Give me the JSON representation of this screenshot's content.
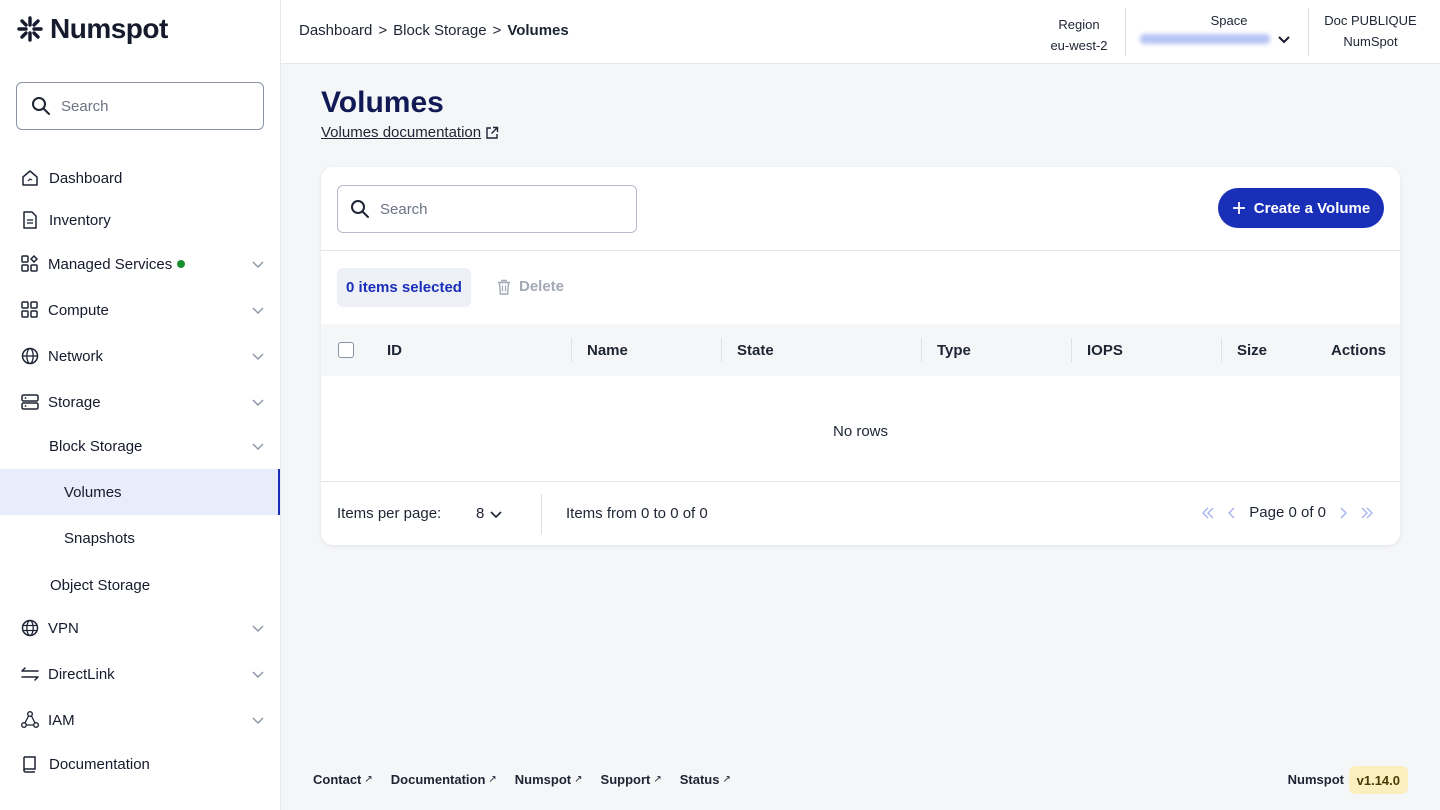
{
  "brand": {
    "name": "Numspot"
  },
  "sidebar": {
    "search_placeholder": "Search",
    "items": [
      {
        "label": "Dashboard"
      },
      {
        "label": "Inventory"
      },
      {
        "label": "Managed Services"
      },
      {
        "label": "Compute"
      },
      {
        "label": "Network"
      },
      {
        "label": "Storage"
      },
      {
        "label": "Block Storage"
      },
      {
        "label": "Volumes"
      },
      {
        "label": "Snapshots"
      },
      {
        "label": "Object Storage"
      },
      {
        "label": "VPN"
      },
      {
        "label": "DirectLink"
      },
      {
        "label": "IAM"
      },
      {
        "label": "Documentation"
      }
    ]
  },
  "header": {
    "breadcrumb": [
      "Dashboard",
      "Block Storage",
      "Volumes"
    ],
    "breadcrumb_sep": ">",
    "region_label": "Region",
    "region_value": "eu-west-2",
    "space_label": "Space",
    "org_label": "Doc PUBLIQUE",
    "org_value": "NumSpot"
  },
  "main": {
    "title": "Volumes",
    "doc_link": "Volumes documentation",
    "search_placeholder": "Search",
    "create_button": "Create a Volume",
    "selected_text": "0 items selected",
    "delete_label": "Delete",
    "columns": [
      "ID",
      "Name",
      "State",
      "Type",
      "IOPS",
      "Size",
      "Actions"
    ],
    "empty_text": "No rows",
    "items_per_page_label": "Items per page:",
    "items_per_page_value": "8",
    "items_range": "Items from 0 to 0 of 0",
    "page_text": "Page 0 of 0"
  },
  "footer": {
    "links": [
      "Contact",
      "Documentation",
      "Numspot",
      "Support",
      "Status"
    ],
    "brand": "Numspot",
    "version": "v1.14.0"
  },
  "colors": {
    "accent": "#1a2fb8",
    "title": "#111a55",
    "active_bg": "#e8ecfb",
    "status_green": "#1a8f2d",
    "version_bg": "#fbefc0"
  }
}
